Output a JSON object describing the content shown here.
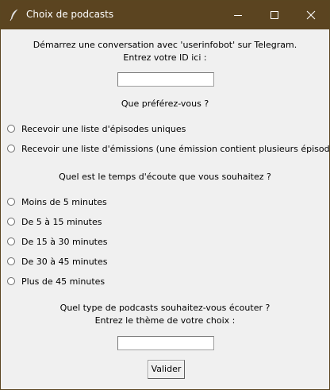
{
  "window": {
    "title": "Choix de podcasts",
    "colors": {
      "titlebar": "#5b4420",
      "background": "#f0f0f0"
    }
  },
  "telegram": {
    "line1": "Démarrez une conversation avec 'userinfobot' sur Telegram.",
    "line2": "Entrez votre ID ici :",
    "id_value": ""
  },
  "preference": {
    "question": "Que préférez-vous ?",
    "options": [
      "Recevoir une liste d'épisodes uniques",
      "Recevoir une liste d'émissions (une émission contient plusieurs épisodes)"
    ]
  },
  "duration": {
    "question": "Quel est le temps d'écoute que vous souhaitez ?",
    "options": [
      "Moins de 5 minutes",
      "De 5 à 15 minutes",
      "De 15 à 30 minutes",
      "De 30 à 45 minutes",
      "Plus de 45 minutes"
    ]
  },
  "theme": {
    "line1": "Quel type de podcasts souhaitez-vous écouter ?",
    "line2": "Entrez le thème de votre choix :",
    "value": ""
  },
  "submit_label": "Valider"
}
